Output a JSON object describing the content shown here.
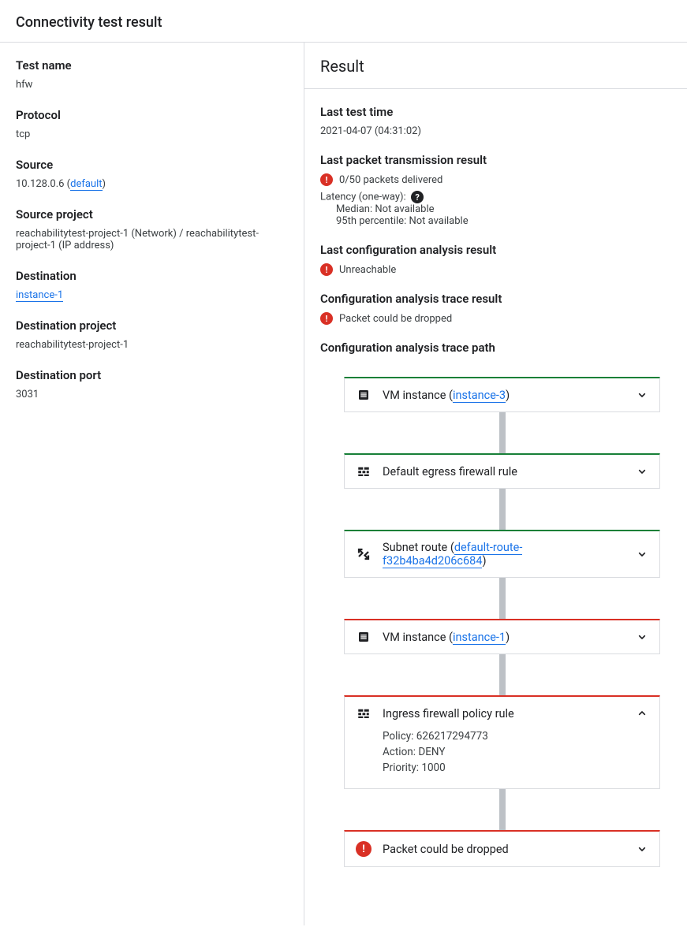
{
  "page_title": "Connectivity test result",
  "left": {
    "test_name_label": "Test name",
    "test_name": "hfw",
    "protocol_label": "Protocol",
    "protocol": "tcp",
    "source_label": "Source",
    "source_ip": "10.128.0.6 (",
    "source_link": "default",
    "source_close": ")",
    "source_project_label": "Source project",
    "source_project": "reachabilitytest-project-1 (Network) / reachabilitytest-project-1 (IP address)",
    "dest_label": "Destination",
    "dest_link": "instance-1",
    "dest_project_label": "Destination project",
    "dest_project": "reachabilitytest-project-1",
    "dest_port_label": "Destination port",
    "dest_port": "3031"
  },
  "right": {
    "result_heading": "Result",
    "last_test_time_label": "Last test time",
    "last_test_time": "2021-04-07 (04:31:02)",
    "pkt_label": "Last packet transmission result",
    "pkt_delivered": "0/50 packets delivered",
    "latency_label": "Latency (one-way):",
    "latency_median": "Median: Not available",
    "latency_p95": "95th percentile: Not available",
    "cfg_analysis_label": "Last configuration analysis result",
    "cfg_analysis_status": "Unreachable",
    "trace_result_label": "Configuration analysis trace result",
    "trace_result_status": "Packet could be dropped",
    "trace_path_label": "Configuration analysis trace path"
  },
  "trace": [
    {
      "color": "green",
      "icon": "vm",
      "title_prefix": "VM instance (",
      "link": "instance-3",
      "title_suffix": ")",
      "expanded": false
    },
    {
      "color": "green",
      "icon": "firewall",
      "title": "Default egress firewall rule",
      "expanded": false
    },
    {
      "color": "green",
      "icon": "route",
      "title_prefix": "Subnet route (",
      "link": "default-route-f32b4ba4d206c684",
      "title_suffix": ")",
      "expanded": false
    },
    {
      "color": "red",
      "icon": "vm",
      "title_prefix": "VM instance (",
      "link": "instance-1",
      "title_suffix": ")",
      "expanded": false
    },
    {
      "color": "red",
      "icon": "firewall",
      "title": "Ingress firewall policy rule",
      "expanded": true,
      "details": [
        "Policy: 626217294773",
        "Action: DENY",
        "Priority: 1000"
      ]
    },
    {
      "color": "red",
      "icon": "error",
      "title": "Packet could be dropped",
      "expanded": false
    }
  ]
}
